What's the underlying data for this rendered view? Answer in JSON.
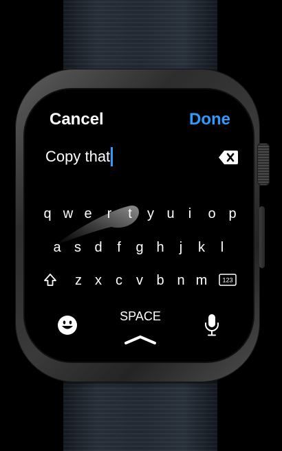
{
  "header": {
    "cancel_label": "Cancel",
    "done_label": "Done"
  },
  "input": {
    "value": "Copy that"
  },
  "keyboard": {
    "row1": [
      "q",
      "w",
      "e",
      "r",
      "t",
      "y",
      "u",
      "i",
      "o",
      "p"
    ],
    "row2": [
      "a",
      "s",
      "d",
      "f",
      "g",
      "h",
      "j",
      "k",
      "l"
    ],
    "row3": [
      "z",
      "x",
      "c",
      "v",
      "b",
      "n",
      "m"
    ],
    "numbers_key_label": "123",
    "space_label": "SPACE"
  },
  "icons": {
    "delete": "backspace-icon",
    "shift": "shift-icon",
    "emoji": "emoji-icon",
    "mic": "microphone-icon",
    "expand": "chevron-up-icon"
  },
  "colors": {
    "accent": "#2f9bff",
    "text": "#ffffff",
    "screen": "#000000"
  }
}
